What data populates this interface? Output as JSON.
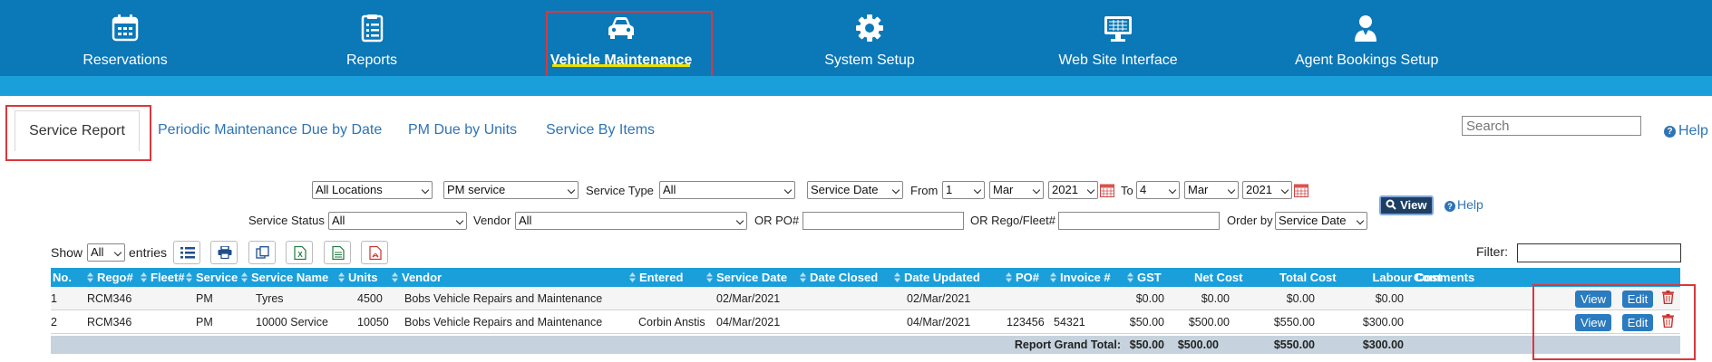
{
  "nav": {
    "items": [
      {
        "label": "Reservations",
        "icon": "calendar-icon"
      },
      {
        "label": "Reports",
        "icon": "clipboard-icon"
      },
      {
        "label": "Vehicle Maintenance",
        "icon": "car-icon",
        "active": true
      },
      {
        "label": "System Setup",
        "icon": "gear-icon"
      },
      {
        "label": "Web Site Interface",
        "icon": "monitor-icon"
      },
      {
        "label": "Agent Bookings Setup",
        "icon": "user-icon"
      }
    ]
  },
  "tabs": [
    {
      "label": "Service Report",
      "active": true
    },
    {
      "label": "Periodic Maintenance Due by Date"
    },
    {
      "label": "PM Due by Units"
    },
    {
      "label": "Service By Items"
    }
  ],
  "search": {
    "placeholder": "Search"
  },
  "help_label": "Help",
  "filters": {
    "location": "All Locations",
    "category": "PM service",
    "service_type_label": "Service Type",
    "service_type": "All",
    "date_field": "Service Date",
    "from_label": "From",
    "from_day": "1",
    "from_month": "Mar",
    "from_year": "2021",
    "to_label": "To",
    "to_day": "4",
    "to_month": "Mar",
    "to_year": "2021",
    "view_label": "View",
    "help_label": "Help",
    "service_status_label": "Service Status",
    "service_status": "All",
    "vendor_label": "Vendor",
    "vendor": "All",
    "po_label": "OR PO#",
    "rego_label": "OR Rego/Fleet#",
    "order_label": "Order by",
    "order_by": "Service Date"
  },
  "entries": {
    "show_label": "Show",
    "value": "All",
    "suffix": "entries"
  },
  "filter_label": "Filter:",
  "table": {
    "headers": [
      "No.",
      "Rego#",
      "Fleet#",
      "Service",
      "Service Name",
      "Units",
      "Vendor",
      "Entered",
      "Service Date",
      "Date Closed",
      "Date Updated",
      "PO#",
      "Invoice #",
      "GST",
      "Net Cost",
      "Total Cost",
      "Labour Cost",
      "Comments"
    ],
    "rows": [
      {
        "no": "1",
        "rego": "RCM346",
        "fleet": "",
        "service": "PM",
        "service_name": "Tyres",
        "units": "4500",
        "vendor": "Bobs Vehicle Repairs and Maintenance",
        "entered": "",
        "service_date": "02/Mar/2021",
        "date_closed": "",
        "date_updated": "02/Mar/2021",
        "po": "",
        "invoice": "",
        "gst": "$0.00",
        "net_cost": "$0.00",
        "total_cost": "$0.00",
        "labour_cost": "$0.00",
        "comments": ""
      },
      {
        "no": "2",
        "rego": "RCM346",
        "fleet": "",
        "service": "PM",
        "service_name": "10000 Service",
        "units": "10050",
        "vendor": "Bobs Vehicle Repairs and Maintenance",
        "entered": "Corbin Anstis",
        "service_date": "04/Mar/2021",
        "date_closed": "",
        "date_updated": "04/Mar/2021",
        "po": "123456",
        "invoice": "54321",
        "gst": "$50.00",
        "net_cost": "$500.00",
        "total_cost": "$550.00",
        "labour_cost": "$300.00",
        "comments": ""
      }
    ],
    "row_actions": {
      "view": "View",
      "edit": "Edit"
    },
    "footer": {
      "label": "Report Grand Total:",
      "gst": "$50.00",
      "net_cost": "$500.00",
      "total_cost": "$550.00",
      "labour_cost": "$300.00"
    }
  },
  "colors": {
    "nav_bg": "#0b78b8",
    "stripe": "#1a9fdb",
    "highlight": "#d9383c",
    "link": "#2f74b5"
  }
}
